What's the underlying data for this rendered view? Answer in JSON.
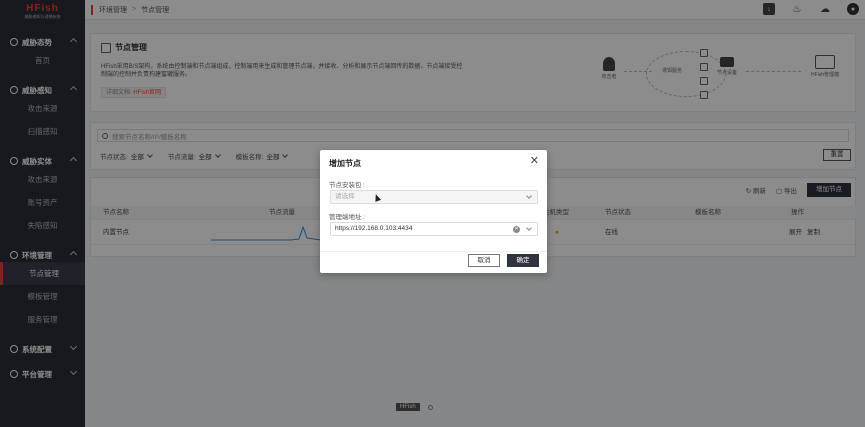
{
  "app": {
    "logo_text": "HFish",
    "logo_sub": "威胁感知与诱捕系统"
  },
  "sidebar": {
    "groups": [
      {
        "label": "威胁态势",
        "items": [
          "首页"
        ]
      },
      {
        "label": "威胁感知",
        "items": [
          "攻击来源",
          "扫描感知"
        ]
      },
      {
        "label": "威胁实体",
        "items": [
          "攻击来源",
          "账号资产",
          "失陷感知"
        ]
      },
      {
        "label": "环境管理",
        "items": [
          "节点管理",
          "模板管理",
          "服务管理"
        ]
      },
      {
        "label": "系统配置",
        "items": []
      },
      {
        "label": "平台管理",
        "items": []
      }
    ],
    "active_item": "节点管理"
  },
  "topbar": {
    "breadcrumb": [
      "环境管理",
      "节点管理"
    ]
  },
  "intro": {
    "title": "节点管理",
    "description": "HFish采用B/S架构，系统由控制端和节点端组成，控制端用来生成和管理节点端，并接收、分析和展示节点端回传的数据，节点端接受控制端的控制并负责构建蜜罐服务。",
    "doc_label": "详细文档:",
    "doc_link": "HFish官网",
    "diagram": {
      "attacker": "攻击者",
      "decoy_service": "诱饵服务",
      "node": "节点设备",
      "manager": "HFish管理端"
    }
  },
  "filters": {
    "search_placeholder": "搜索节点名称/IP/模板名称",
    "status_label": "节点状态:",
    "status_value": "全部",
    "traffic_label": "节点流量:",
    "traffic_value": "全部",
    "template_label": "模板名称:",
    "template_value": "全部",
    "reset_label": "重置"
  },
  "table": {
    "refresh_label": "刷新",
    "export_label": "导出",
    "add_label": "增加节点",
    "columns": [
      "节点名称",
      "节点流量",
      "主机类型",
      "节点状态",
      "模板名称",
      "操作"
    ],
    "rows": [
      {
        "name": "内置节点",
        "host_type": "",
        "status": "在线",
        "template": "",
        "actions": [
          "展开",
          "复制"
        ]
      }
    ]
  },
  "footer": {
    "tag": "HFish"
  },
  "modal": {
    "title": "增加节点",
    "package_label": "节点安装包",
    "package_placeholder": "请选择",
    "address_label": "管理端地址",
    "address_value": "https://192.168.0.103:4434",
    "cancel_label": "取消",
    "ok_label": "确定"
  },
  "colors": {
    "accent": "#e8433a",
    "sidebar_bg": "#2b2f3a",
    "primary_button": "#2f3440",
    "status_ok": "#3aa55a"
  }
}
